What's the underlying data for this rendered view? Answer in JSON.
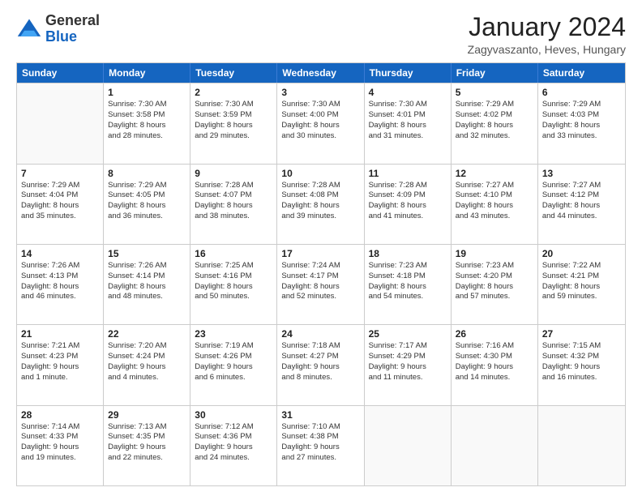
{
  "header": {
    "logo": {
      "general": "General",
      "blue": "Blue"
    },
    "title": "January 2024",
    "location": "Zagyvaszanto, Heves, Hungary"
  },
  "weekdays": [
    "Sunday",
    "Monday",
    "Tuesday",
    "Wednesday",
    "Thursday",
    "Friday",
    "Saturday"
  ],
  "weeks": [
    [
      {
        "day": "",
        "lines": []
      },
      {
        "day": "1",
        "lines": [
          "Sunrise: 7:30 AM",
          "Sunset: 3:58 PM",
          "Daylight: 8 hours",
          "and 28 minutes."
        ]
      },
      {
        "day": "2",
        "lines": [
          "Sunrise: 7:30 AM",
          "Sunset: 3:59 PM",
          "Daylight: 8 hours",
          "and 29 minutes."
        ]
      },
      {
        "day": "3",
        "lines": [
          "Sunrise: 7:30 AM",
          "Sunset: 4:00 PM",
          "Daylight: 8 hours",
          "and 30 minutes."
        ]
      },
      {
        "day": "4",
        "lines": [
          "Sunrise: 7:30 AM",
          "Sunset: 4:01 PM",
          "Daylight: 8 hours",
          "and 31 minutes."
        ]
      },
      {
        "day": "5",
        "lines": [
          "Sunrise: 7:29 AM",
          "Sunset: 4:02 PM",
          "Daylight: 8 hours",
          "and 32 minutes."
        ]
      },
      {
        "day": "6",
        "lines": [
          "Sunrise: 7:29 AM",
          "Sunset: 4:03 PM",
          "Daylight: 8 hours",
          "and 33 minutes."
        ]
      }
    ],
    [
      {
        "day": "7",
        "lines": [
          "Sunrise: 7:29 AM",
          "Sunset: 4:04 PM",
          "Daylight: 8 hours",
          "and 35 minutes."
        ]
      },
      {
        "day": "8",
        "lines": [
          "Sunrise: 7:29 AM",
          "Sunset: 4:05 PM",
          "Daylight: 8 hours",
          "and 36 minutes."
        ]
      },
      {
        "day": "9",
        "lines": [
          "Sunrise: 7:28 AM",
          "Sunset: 4:07 PM",
          "Daylight: 8 hours",
          "and 38 minutes."
        ]
      },
      {
        "day": "10",
        "lines": [
          "Sunrise: 7:28 AM",
          "Sunset: 4:08 PM",
          "Daylight: 8 hours",
          "and 39 minutes."
        ]
      },
      {
        "day": "11",
        "lines": [
          "Sunrise: 7:28 AM",
          "Sunset: 4:09 PM",
          "Daylight: 8 hours",
          "and 41 minutes."
        ]
      },
      {
        "day": "12",
        "lines": [
          "Sunrise: 7:27 AM",
          "Sunset: 4:10 PM",
          "Daylight: 8 hours",
          "and 43 minutes."
        ]
      },
      {
        "day": "13",
        "lines": [
          "Sunrise: 7:27 AM",
          "Sunset: 4:12 PM",
          "Daylight: 8 hours",
          "and 44 minutes."
        ]
      }
    ],
    [
      {
        "day": "14",
        "lines": [
          "Sunrise: 7:26 AM",
          "Sunset: 4:13 PM",
          "Daylight: 8 hours",
          "and 46 minutes."
        ]
      },
      {
        "day": "15",
        "lines": [
          "Sunrise: 7:26 AM",
          "Sunset: 4:14 PM",
          "Daylight: 8 hours",
          "and 48 minutes."
        ]
      },
      {
        "day": "16",
        "lines": [
          "Sunrise: 7:25 AM",
          "Sunset: 4:16 PM",
          "Daylight: 8 hours",
          "and 50 minutes."
        ]
      },
      {
        "day": "17",
        "lines": [
          "Sunrise: 7:24 AM",
          "Sunset: 4:17 PM",
          "Daylight: 8 hours",
          "and 52 minutes."
        ]
      },
      {
        "day": "18",
        "lines": [
          "Sunrise: 7:23 AM",
          "Sunset: 4:18 PM",
          "Daylight: 8 hours",
          "and 54 minutes."
        ]
      },
      {
        "day": "19",
        "lines": [
          "Sunrise: 7:23 AM",
          "Sunset: 4:20 PM",
          "Daylight: 8 hours",
          "and 57 minutes."
        ]
      },
      {
        "day": "20",
        "lines": [
          "Sunrise: 7:22 AM",
          "Sunset: 4:21 PM",
          "Daylight: 8 hours",
          "and 59 minutes."
        ]
      }
    ],
    [
      {
        "day": "21",
        "lines": [
          "Sunrise: 7:21 AM",
          "Sunset: 4:23 PM",
          "Daylight: 9 hours",
          "and 1 minute."
        ]
      },
      {
        "day": "22",
        "lines": [
          "Sunrise: 7:20 AM",
          "Sunset: 4:24 PM",
          "Daylight: 9 hours",
          "and 4 minutes."
        ]
      },
      {
        "day": "23",
        "lines": [
          "Sunrise: 7:19 AM",
          "Sunset: 4:26 PM",
          "Daylight: 9 hours",
          "and 6 minutes."
        ]
      },
      {
        "day": "24",
        "lines": [
          "Sunrise: 7:18 AM",
          "Sunset: 4:27 PM",
          "Daylight: 9 hours",
          "and 8 minutes."
        ]
      },
      {
        "day": "25",
        "lines": [
          "Sunrise: 7:17 AM",
          "Sunset: 4:29 PM",
          "Daylight: 9 hours",
          "and 11 minutes."
        ]
      },
      {
        "day": "26",
        "lines": [
          "Sunrise: 7:16 AM",
          "Sunset: 4:30 PM",
          "Daylight: 9 hours",
          "and 14 minutes."
        ]
      },
      {
        "day": "27",
        "lines": [
          "Sunrise: 7:15 AM",
          "Sunset: 4:32 PM",
          "Daylight: 9 hours",
          "and 16 minutes."
        ]
      }
    ],
    [
      {
        "day": "28",
        "lines": [
          "Sunrise: 7:14 AM",
          "Sunset: 4:33 PM",
          "Daylight: 9 hours",
          "and 19 minutes."
        ]
      },
      {
        "day": "29",
        "lines": [
          "Sunrise: 7:13 AM",
          "Sunset: 4:35 PM",
          "Daylight: 9 hours",
          "and 22 minutes."
        ]
      },
      {
        "day": "30",
        "lines": [
          "Sunrise: 7:12 AM",
          "Sunset: 4:36 PM",
          "Daylight: 9 hours",
          "and 24 minutes."
        ]
      },
      {
        "day": "31",
        "lines": [
          "Sunrise: 7:10 AM",
          "Sunset: 4:38 PM",
          "Daylight: 9 hours",
          "and 27 minutes."
        ]
      },
      {
        "day": "",
        "lines": []
      },
      {
        "day": "",
        "lines": []
      },
      {
        "day": "",
        "lines": []
      }
    ]
  ]
}
